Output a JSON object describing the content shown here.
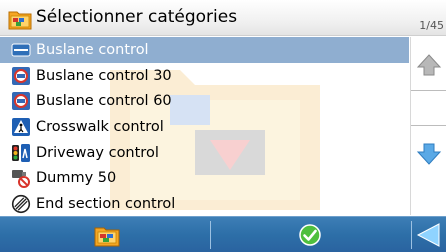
{
  "header": {
    "title": "Sélectionner catégories",
    "page_counter": "1/45",
    "icon": "folder-categories-icon"
  },
  "list": {
    "items": [
      {
        "label": "Buslane control",
        "icon": "buslane-icon",
        "selected": true
      },
      {
        "label": "Buslane control 30",
        "icon": "buslane-30-icon",
        "selected": false
      },
      {
        "label": "Buslane control 60",
        "icon": "buslane-60-icon",
        "selected": false
      },
      {
        "label": "Crosswalk control",
        "icon": "crosswalk-icon",
        "selected": false
      },
      {
        "label": "Driveway control",
        "icon": "traffic-light-icon",
        "selected": false
      },
      {
        "label": "Dummy 50",
        "icon": "dummy-camera-icon",
        "selected": false
      },
      {
        "label": "End section control",
        "icon": "end-section-icon",
        "selected": false
      }
    ]
  },
  "scroll": {
    "up_icon": "scroll-up-icon",
    "down_icon": "scroll-down-icon"
  },
  "toolbar": {
    "left_icon": "categories-folder-icon",
    "middle_icon": "confirm-check-icon",
    "right_icon": "back-arrow-icon"
  },
  "colors": {
    "selection": "#8faed0",
    "toolbar": "#2d6fa8",
    "rail_arrow_up": "#b8b8b8",
    "rail_arrow_down": "#5aa9e6"
  }
}
